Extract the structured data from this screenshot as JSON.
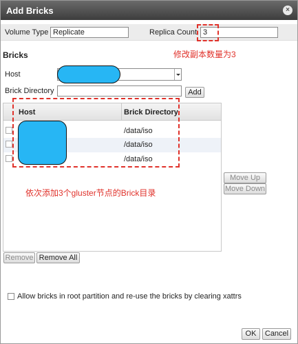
{
  "dialog": {
    "title": "Add Bricks",
    "close_glyph": "×"
  },
  "volume": {
    "type_label": "Volume Type",
    "type_value": "Replicate",
    "replica_label": "Replica Count",
    "replica_value": "3"
  },
  "bricks": {
    "section_label": "Bricks",
    "host_label": "Host",
    "dir_label": "Brick Directory",
    "dir_value": "",
    "add_label": "Add",
    "grid": {
      "columns": [
        "Host",
        "Brick Directory"
      ],
      "rows": [
        {
          "dir": "/data/iso"
        },
        {
          "dir": "/data/iso"
        },
        {
          "dir": "/data/iso"
        }
      ]
    },
    "move_up_label": "Move Up",
    "move_down_label": "Move Down",
    "remove_label": "Remove",
    "remove_all_label": "Remove All"
  },
  "allow_root": {
    "label": "Allow bricks in root partition and re-use the bricks by clearing xattrs"
  },
  "footer": {
    "ok_label": "OK",
    "cancel_label": "Cancel"
  },
  "annotations": {
    "replica_note": "修改副本数量为3",
    "bricks_note": "依次添加3个gluster节点的Brick目录",
    "color": "#e0312a"
  },
  "colors": {
    "title_bar": "#4a4a4a",
    "mask": "#27b6f4"
  }
}
